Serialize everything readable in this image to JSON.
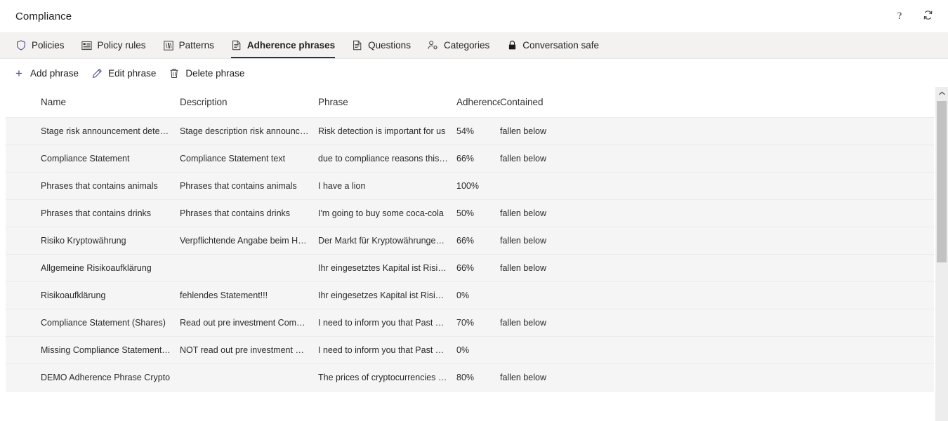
{
  "window": {
    "title": "Compliance",
    "help_tooltip": "?",
    "refresh_tooltip": "Refresh"
  },
  "tabs": [
    {
      "label": "Policies",
      "icon": "shield-icon",
      "active": false
    },
    {
      "label": "Policy rules",
      "icon": "list-box-icon",
      "active": false
    },
    {
      "label": "Patterns",
      "icon": "pattern-grid-icon",
      "active": false
    },
    {
      "label": "Adherence phrases",
      "icon": "document-text-icon",
      "active": true
    },
    {
      "label": "Questions",
      "icon": "document-text-icon",
      "active": false
    },
    {
      "label": "Categories",
      "icon": "person-settings-icon",
      "active": false
    },
    {
      "label": "Conversation safe",
      "icon": "lock-icon",
      "active": false
    }
  ],
  "toolbar": [
    {
      "label": "Add phrase",
      "icon": "plus-icon"
    },
    {
      "label": "Edit phrase",
      "icon": "pencil-icon"
    },
    {
      "label": "Delete phrase",
      "icon": "trash-icon"
    }
  ],
  "table": {
    "columns": [
      "Name",
      "Description",
      "Phrase",
      "Adherence",
      "Contained"
    ],
    "rows": [
      {
        "name": "Stage risk announcement detection",
        "description": "Stage description risk announceme...",
        "phrase": "Risk detection is important for us",
        "adherence": "54%",
        "contained": "fallen below"
      },
      {
        "name": "Compliance Statement",
        "description": "Compliance Statement text",
        "phrase": "due to compliance reasons this call ...",
        "adherence": "66%",
        "contained": "fallen below"
      },
      {
        "name": "Phrases that contains animals",
        "description": "Phrases that contains animals",
        "phrase": "I have a lion",
        "adherence": "100%",
        "contained": ""
      },
      {
        "name": "Phrases that contains drinks",
        "description": "Phrases that contains drinks",
        "phrase": "I'm going to buy some coca-cola",
        "adherence": "50%",
        "contained": "fallen below"
      },
      {
        "name": "Risiko Kryptowährung",
        "description": "Verpflichtende Angabe beim Hande...",
        "phrase": "Der Markt für Kryptowährungen ist ...",
        "adherence": "66%",
        "contained": "fallen below"
      },
      {
        "name": "Allgemeine Risikoaufklärung",
        "description": "",
        "phrase": "Ihr eingesetztes Kapital ist Risiken a...",
        "adherence": "66%",
        "contained": "fallen below"
      },
      {
        "name": "Risikoaufklärung",
        "description": "fehlendes Statement!!!",
        "phrase": "Ihr eingesetzes Kapital ist Risiken au...",
        "adherence": "0%",
        "contained": ""
      },
      {
        "name": "Compliance Statement (Shares)",
        "description": "Read out pre investment Complianc...",
        "phrase": "I need to inform you that Past perfo...",
        "adherence": "70%",
        "contained": "fallen below"
      },
      {
        "name": "Missing Compliance Statement (Sha...",
        "description": "NOT read out pre investment Comp...",
        "phrase": "I need to inform you that Past perfo...",
        "adherence": "0%",
        "contained": ""
      },
      {
        "name": "DEMO Adherence Phrase Crypto",
        "description": "",
        "phrase": "The prices of cryptocurrencies are u...",
        "adherence": "80%",
        "contained": "fallen below"
      }
    ]
  },
  "scrollbar": {
    "up_arrow": "chevron-up-icon"
  },
  "colors": {
    "active_tab_underline": "#0f3b5c",
    "tabbar_background": "#f3f2f1",
    "row_background": "#f5f5f5",
    "add_icon": "#4b4a8f"
  }
}
